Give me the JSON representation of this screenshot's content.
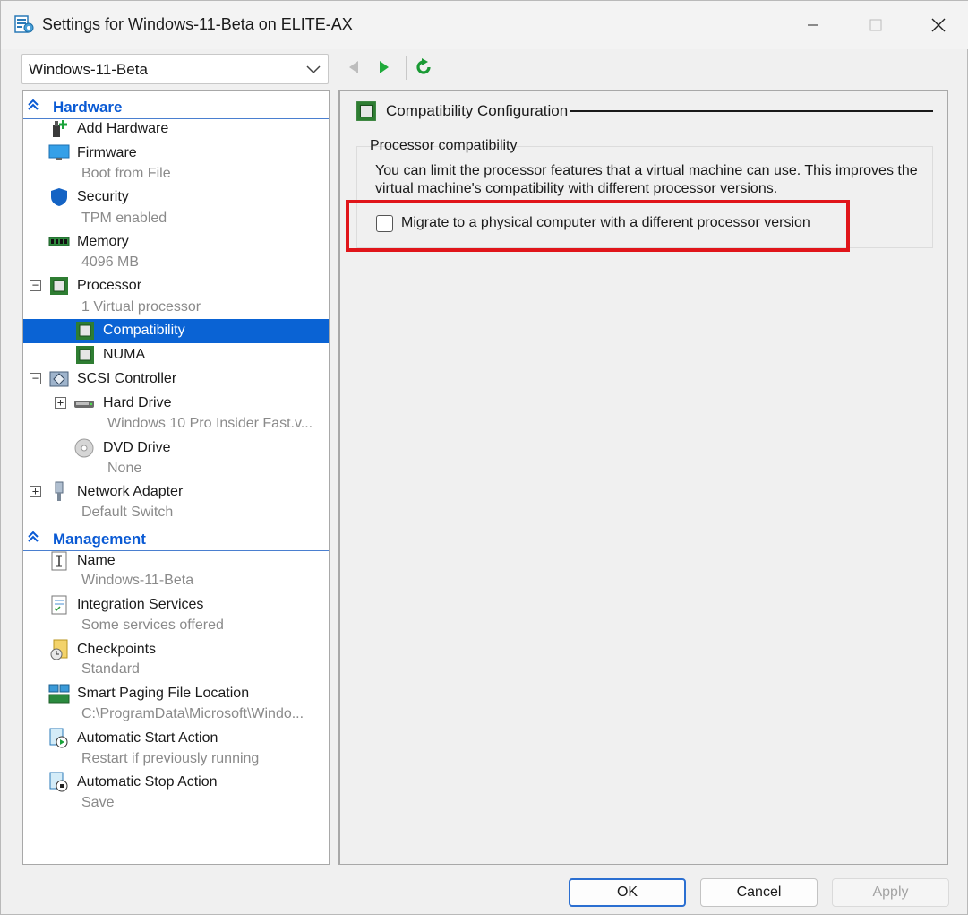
{
  "window": {
    "title": "Settings for Windows-11-Beta on ELITE-AX"
  },
  "vm_selector": {
    "value": "Windows-11-Beta"
  },
  "toolbar": {
    "back_icon": "back-arrow-icon",
    "forward_icon": "forward-arrow-icon",
    "refresh_icon": "refresh-icon"
  },
  "tree": {
    "hardware_header": "Hardware",
    "management_header": "Management",
    "items": {
      "add_hardware": {
        "name": "Add Hardware"
      },
      "firmware": {
        "name": "Firmware",
        "detail": "Boot from File"
      },
      "security": {
        "name": "Security",
        "detail": "TPM enabled"
      },
      "memory": {
        "name": "Memory",
        "detail": "4096 MB"
      },
      "processor": {
        "name": "Processor",
        "detail": "1 Virtual processor",
        "expander": "−"
      },
      "compatibility": {
        "name": "Compatibility"
      },
      "numa": {
        "name": "NUMA"
      },
      "scsi": {
        "name": "SCSI Controller",
        "expander": "−"
      },
      "hard_drive": {
        "name": "Hard Drive",
        "detail": "Windows 10 Pro Insider Fast.v...",
        "expander": "+"
      },
      "dvd_drive": {
        "name": "DVD Drive",
        "detail": "None"
      },
      "network": {
        "name": "Network Adapter",
        "detail": "Default Switch",
        "expander": "+"
      },
      "name": {
        "name": "Name",
        "detail": "Windows-11-Beta"
      },
      "integration": {
        "name": "Integration Services",
        "detail": "Some services offered"
      },
      "checkpoints": {
        "name": "Checkpoints",
        "detail": "Standard"
      },
      "smart_paging": {
        "name": "Smart Paging File Location",
        "detail": "C:\\ProgramData\\Microsoft\\Windo..."
      },
      "auto_start": {
        "name": "Automatic Start Action",
        "detail": "Restart if previously running"
      },
      "auto_stop": {
        "name": "Automatic Stop Action",
        "detail": "Save"
      }
    }
  },
  "content": {
    "section_title": "Compatibility Configuration",
    "group_label": "Processor compatibility",
    "description": "You can limit the processor features that a virtual machine can use. This improves the virtual machine's compatibility with different processor versions.",
    "checkbox_label": "Migrate to a physical computer with a different processor version",
    "checkbox_checked": false
  },
  "buttons": {
    "ok": "OK",
    "cancel": "Cancel",
    "apply": "Apply"
  },
  "colors": {
    "accent": "#0a63d4",
    "section_header": "#0a5ad4",
    "highlight": "#e0151a"
  }
}
